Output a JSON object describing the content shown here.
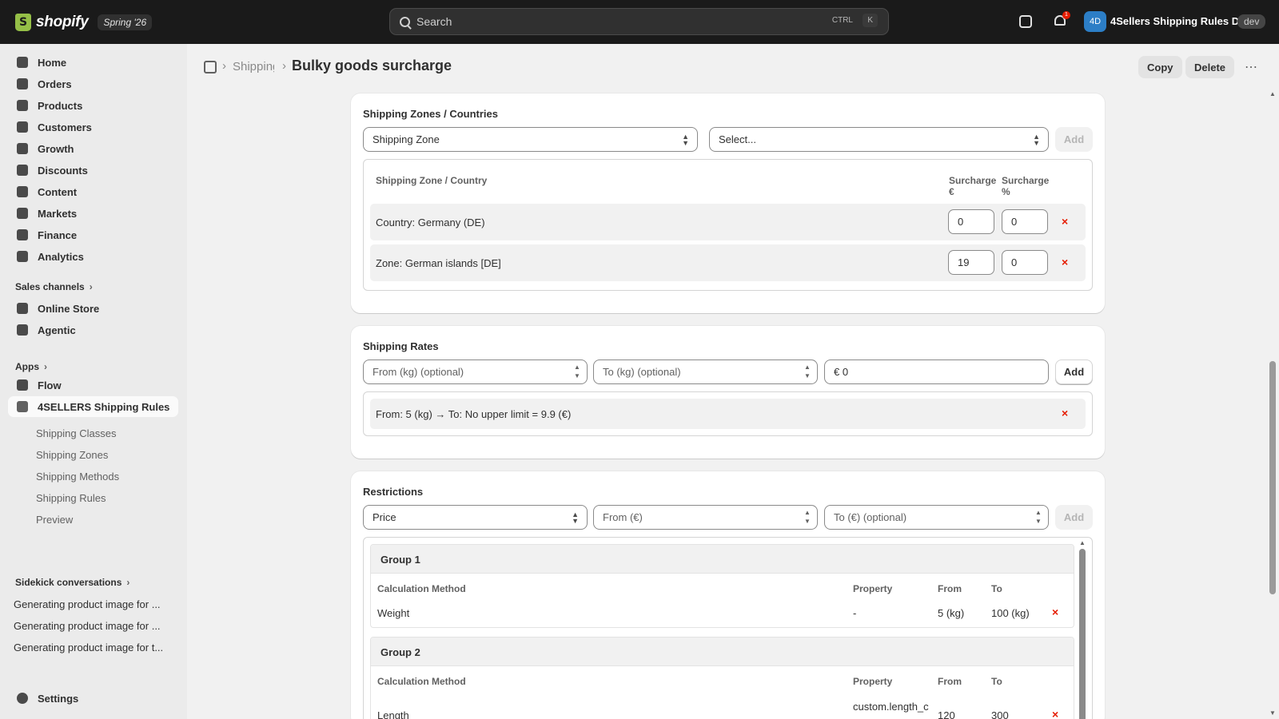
{
  "topbar": {
    "brand": "shopify",
    "edition": "Spring '26",
    "search_placeholder": "Search",
    "shortcut_ctrl": "CTRL",
    "shortcut_key": "K",
    "notification_count": "1",
    "avatar_initials": "4D",
    "store_name": "4Sellers Shipping Rules D...",
    "env_badge": "dev"
  },
  "sidebar": {
    "main_items": [
      {
        "label": "Home",
        "icon": "home-icon"
      },
      {
        "label": "Orders",
        "icon": "orders-icon"
      },
      {
        "label": "Products",
        "icon": "tag-icon"
      },
      {
        "label": "Customers",
        "icon": "person-icon"
      },
      {
        "label": "Growth",
        "icon": "growth-icon"
      },
      {
        "label": "Discounts",
        "icon": "discount-icon"
      },
      {
        "label": "Content",
        "icon": "content-icon"
      },
      {
        "label": "Markets",
        "icon": "globe-icon"
      },
      {
        "label": "Finance",
        "icon": "bank-icon"
      },
      {
        "label": "Analytics",
        "icon": "bar-chart-icon"
      }
    ],
    "sales_channels_heading": "Sales channels",
    "sales_channels": [
      {
        "label": "Online Store",
        "icon": "store-icon"
      },
      {
        "label": "Agentic",
        "icon": "agentic-icon"
      }
    ],
    "apps_heading": "Apps",
    "apps": [
      {
        "label": "Flow",
        "icon": "flow-icon"
      },
      {
        "label": "4SELLERS Shipping Rules",
        "icon": "app-icon"
      }
    ],
    "app_sub_items": [
      "Shipping Classes",
      "Shipping Zones",
      "Shipping Methods",
      "Shipping Rules",
      "Preview"
    ],
    "sidekick_heading": "Sidekick conversations",
    "sidekick_items": [
      "Generating product image for ...",
      "Generating product image for ...",
      "Generating product image for t..."
    ],
    "settings_label": "Settings"
  },
  "header": {
    "breadcrumb_parent": "Shipping Rules",
    "title": "Bulky goods surcharge",
    "copy_label": "Copy",
    "delete_label": "Delete",
    "more_label": "⋯"
  },
  "zones_card": {
    "title": "Shipping Zones / Countries",
    "type_select": "Shipping Zone",
    "value_select": "Select...",
    "add_label": "Add",
    "col_zone": "Shipping Zone / Country",
    "col_surcharge_eur_1": "Surcharge",
    "col_surcharge_eur_2": "€",
    "col_surcharge_pct_1": "Surcharge",
    "col_surcharge_pct_2": "%",
    "rows": [
      {
        "label": "Country: Germany (DE)",
        "eur": "0",
        "pct": "0"
      },
      {
        "label": "Zone: German islands [DE]",
        "eur": "19",
        "pct": "0"
      }
    ]
  },
  "rates_card": {
    "title": "Shipping Rates",
    "from_placeholder": "From (kg) (optional)",
    "to_placeholder": "To (kg) (optional)",
    "price_value": "€ 0",
    "add_label": "Add",
    "rows": [
      "From: 5 (kg) → To: No upper limit = 9.9 (€)"
    ]
  },
  "restrictions_card": {
    "title": "Restrictions",
    "type_select": "Price",
    "from_placeholder": "From (€)",
    "to_placeholder": "To (€) (optional)",
    "add_label": "Add",
    "col_method": "Calculation Method",
    "col_property": "Property",
    "col_from": "From",
    "col_to": "To",
    "groups": [
      {
        "title": "Group 1",
        "method": "Weight",
        "property": "-",
        "from": "5 (kg)",
        "to": "100 (kg)"
      },
      {
        "title": "Group 2",
        "method": "Length",
        "property": "custom.length_cm",
        "from": "120",
        "to": "300"
      }
    ]
  },
  "colors": {
    "topbar": "#1a1a1a",
    "accent_avatar": "#2c7ec6",
    "danger": "#e51c00",
    "brand_green": "#95bf47"
  }
}
